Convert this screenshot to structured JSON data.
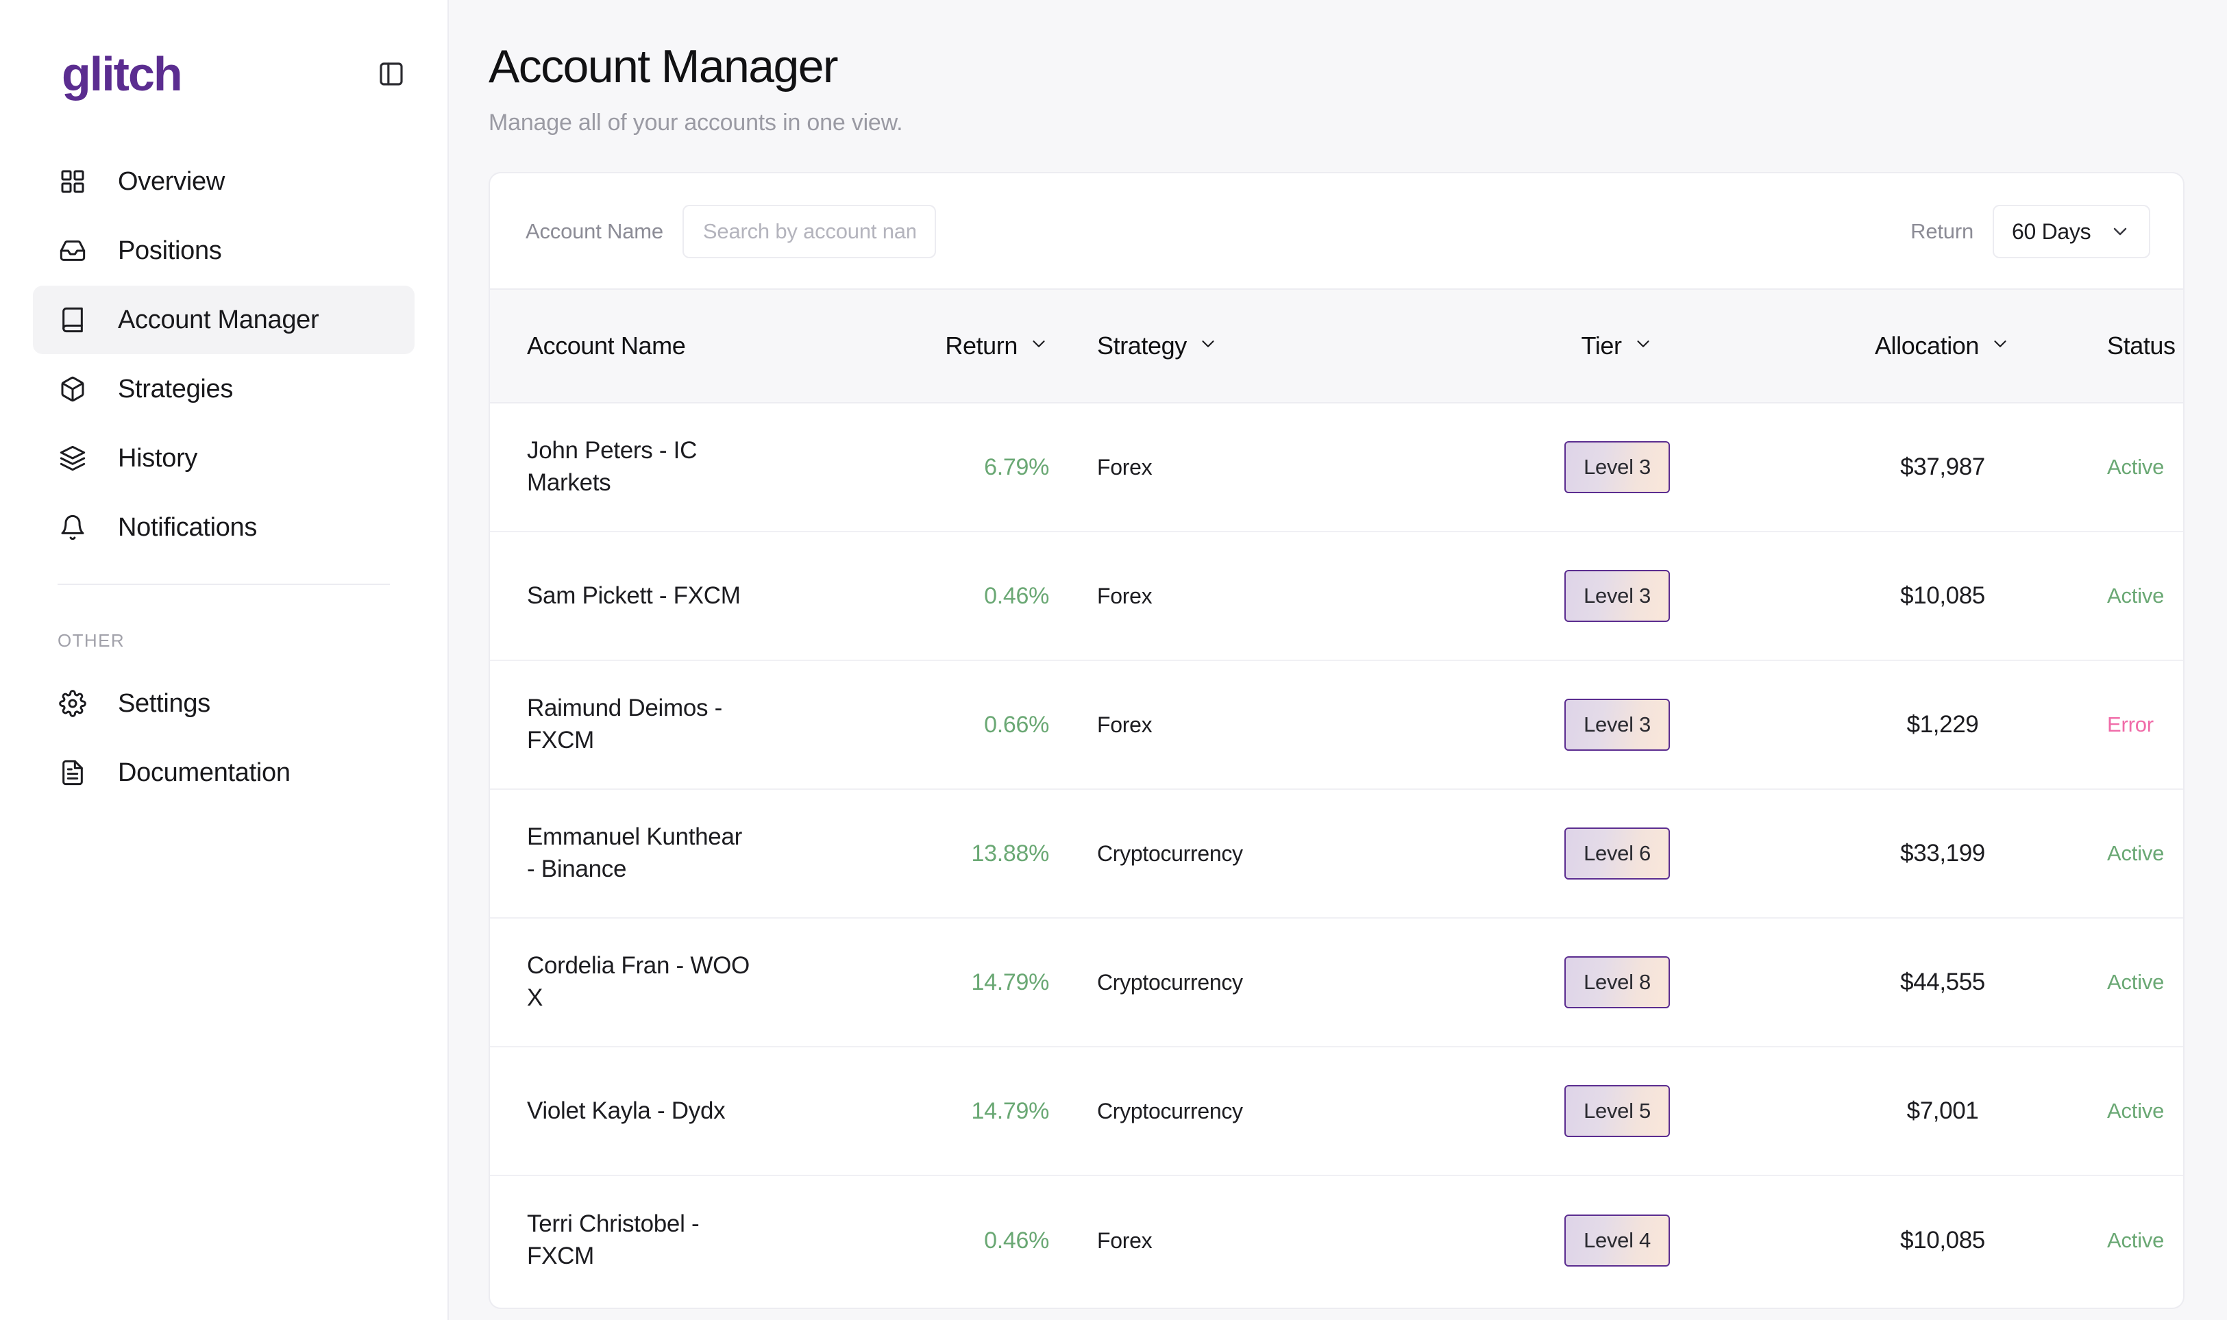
{
  "sidebar": {
    "logo_text": "glitch",
    "toggle_icon": "panel-left-icon",
    "items": [
      {
        "label": "Overview",
        "icon": "grid-icon",
        "active": false
      },
      {
        "label": "Positions",
        "icon": "inbox-icon",
        "active": false
      },
      {
        "label": "Account Manager",
        "icon": "book-icon",
        "active": true
      },
      {
        "label": "Strategies",
        "icon": "box-icon",
        "active": false
      },
      {
        "label": "History",
        "icon": "layers-icon",
        "active": false
      },
      {
        "label": "Notifications",
        "icon": "bell-icon",
        "active": false
      }
    ],
    "section_title": "OTHER",
    "other_items": [
      {
        "label": "Settings",
        "icon": "gear-icon"
      },
      {
        "label": "Documentation",
        "icon": "file-text-icon"
      }
    ]
  },
  "header": {
    "title": "Account Manager",
    "subtitle": "Manage all of your accounts in one view."
  },
  "filters": {
    "account_name_label": "Account Name",
    "search_placeholder": "Search by account name",
    "search_value": "",
    "return_label": "Return",
    "return_selected": "60 Days",
    "return_chevron": "chevron-down-icon"
  },
  "table": {
    "columns": [
      {
        "label": "Account Name",
        "sortable": false
      },
      {
        "label": "Return",
        "sortable": true
      },
      {
        "label": "Strategy",
        "sortable": true
      },
      {
        "label": "Tier",
        "sortable": true
      },
      {
        "label": "Allocation",
        "sortable": true
      },
      {
        "label": "Status",
        "sortable": true
      }
    ],
    "rows": [
      {
        "name": "John Peters - IC Markets",
        "return": "6.79%",
        "strategy": "Forex",
        "tier": "Level 3",
        "allocation": "$37,987",
        "status": "Active",
        "status_kind": "active"
      },
      {
        "name": "Sam Pickett - FXCM",
        "return": "0.46%",
        "strategy": "Forex",
        "tier": "Level 3",
        "allocation": "$10,085",
        "status": "Active",
        "status_kind": "active"
      },
      {
        "name": "Raimund Deimos - FXCM",
        "return": "0.66%",
        "strategy": "Forex",
        "tier": "Level 3",
        "allocation": "$1,229",
        "status": "Error",
        "status_kind": "error"
      },
      {
        "name": "Emmanuel Kunthear - Binance",
        "return": "13.88%",
        "strategy": "Cryptocurrency",
        "tier": "Level 6",
        "allocation": "$33,199",
        "status": "Active",
        "status_kind": "active"
      },
      {
        "name": "Cordelia Fran - WOO X",
        "return": "14.79%",
        "strategy": "Cryptocurrency",
        "tier": "Level 8",
        "allocation": "$44,555",
        "status": "Active",
        "status_kind": "active"
      },
      {
        "name": "Violet Kayla - Dydx",
        "return": "14.79%",
        "strategy": "Cryptocurrency",
        "tier": "Level 5",
        "allocation": "$7,001",
        "status": "Active",
        "status_kind": "active"
      },
      {
        "name": "Terri Christobel - FXCM",
        "return": "0.46%",
        "strategy": "Forex",
        "tier": "Level 4",
        "allocation": "$10,085",
        "status": "Active",
        "status_kind": "active"
      }
    ]
  },
  "colors": {
    "brand_purple": "#5b2d90",
    "status_active": "#6aa874",
    "status_error": "#f06ba8",
    "border": "#ececf1"
  }
}
